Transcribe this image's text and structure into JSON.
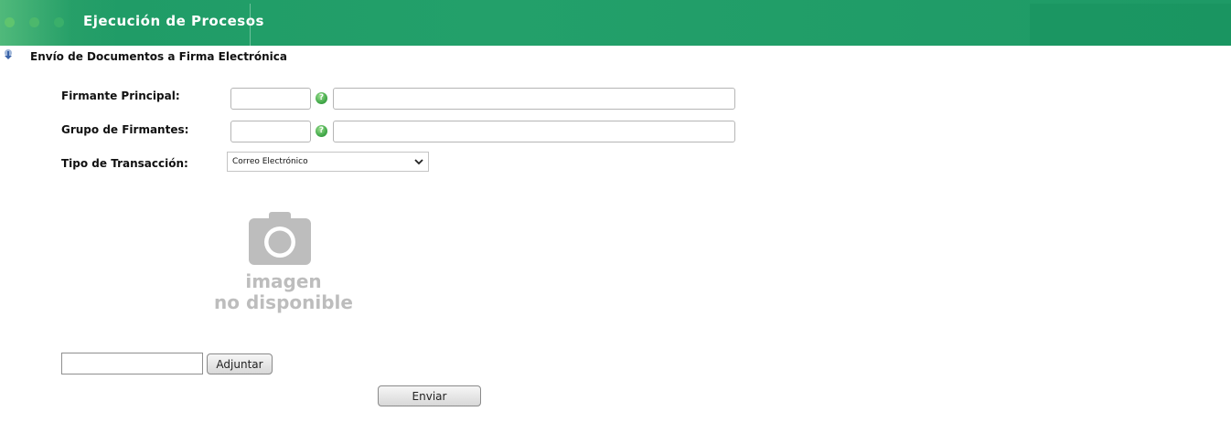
{
  "header": {
    "title": "Ejecución de Procesos"
  },
  "section": {
    "title": "Envío de Documentos a Firma Electrónica",
    "icon": "info-arrow-icon"
  },
  "form": {
    "firmante_principal": {
      "label": "Firmante Principal:",
      "code_value": "",
      "name_value": ""
    },
    "grupo_firmantes": {
      "label": "Grupo de Firmantes:",
      "code_value": "",
      "name_value": ""
    },
    "tipo_transaccion": {
      "label": "Tipo de Transacción:",
      "selected": "Correo Electrónico"
    },
    "help_glyph": "?"
  },
  "image_placeholder": {
    "line1": "imagen",
    "line2": "no disponible",
    "icon": "camera-icon"
  },
  "attachment": {
    "file_value": "",
    "attach_label": "Adjuntar"
  },
  "submit": {
    "label": "Enviar"
  },
  "colors": {
    "header_green": "#1f9b66",
    "help_green": "#43a94a",
    "placeholder_gray": "#bdbdbd"
  }
}
